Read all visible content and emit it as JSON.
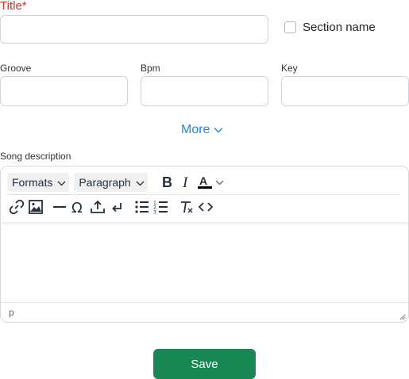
{
  "form": {
    "title_label": "Title*",
    "title_value": "",
    "section_name_label": "Section name",
    "section_name_checked": false,
    "groove_label": "Groove",
    "groove_value": "",
    "bpm_label": "Bpm",
    "bpm_value": "",
    "key_label": "Key",
    "key_value": "",
    "more_label": "More",
    "song_description_label": "Song description",
    "save_label": "Save"
  },
  "editor": {
    "formats_label": "Formats",
    "paragraph_label": "Paragraph",
    "toolbar_row1_icons": [
      "bold-icon",
      "italic-icon",
      "text-color-icon",
      "chevron-down-icon"
    ],
    "toolbar_row2_icons": [
      "link-icon",
      "image-icon",
      "horizontal-line-icon",
      "special-character-icon",
      "upload-icon",
      "line-break-icon",
      "bullet-list-icon",
      "numbered-list-icon",
      "clear-formatting-icon",
      "source-code-icon"
    ],
    "content": "",
    "status_path": "p"
  },
  "colors": {
    "title_label": "#c0392b",
    "link": "#1e88e5",
    "save_button": "#198754"
  }
}
